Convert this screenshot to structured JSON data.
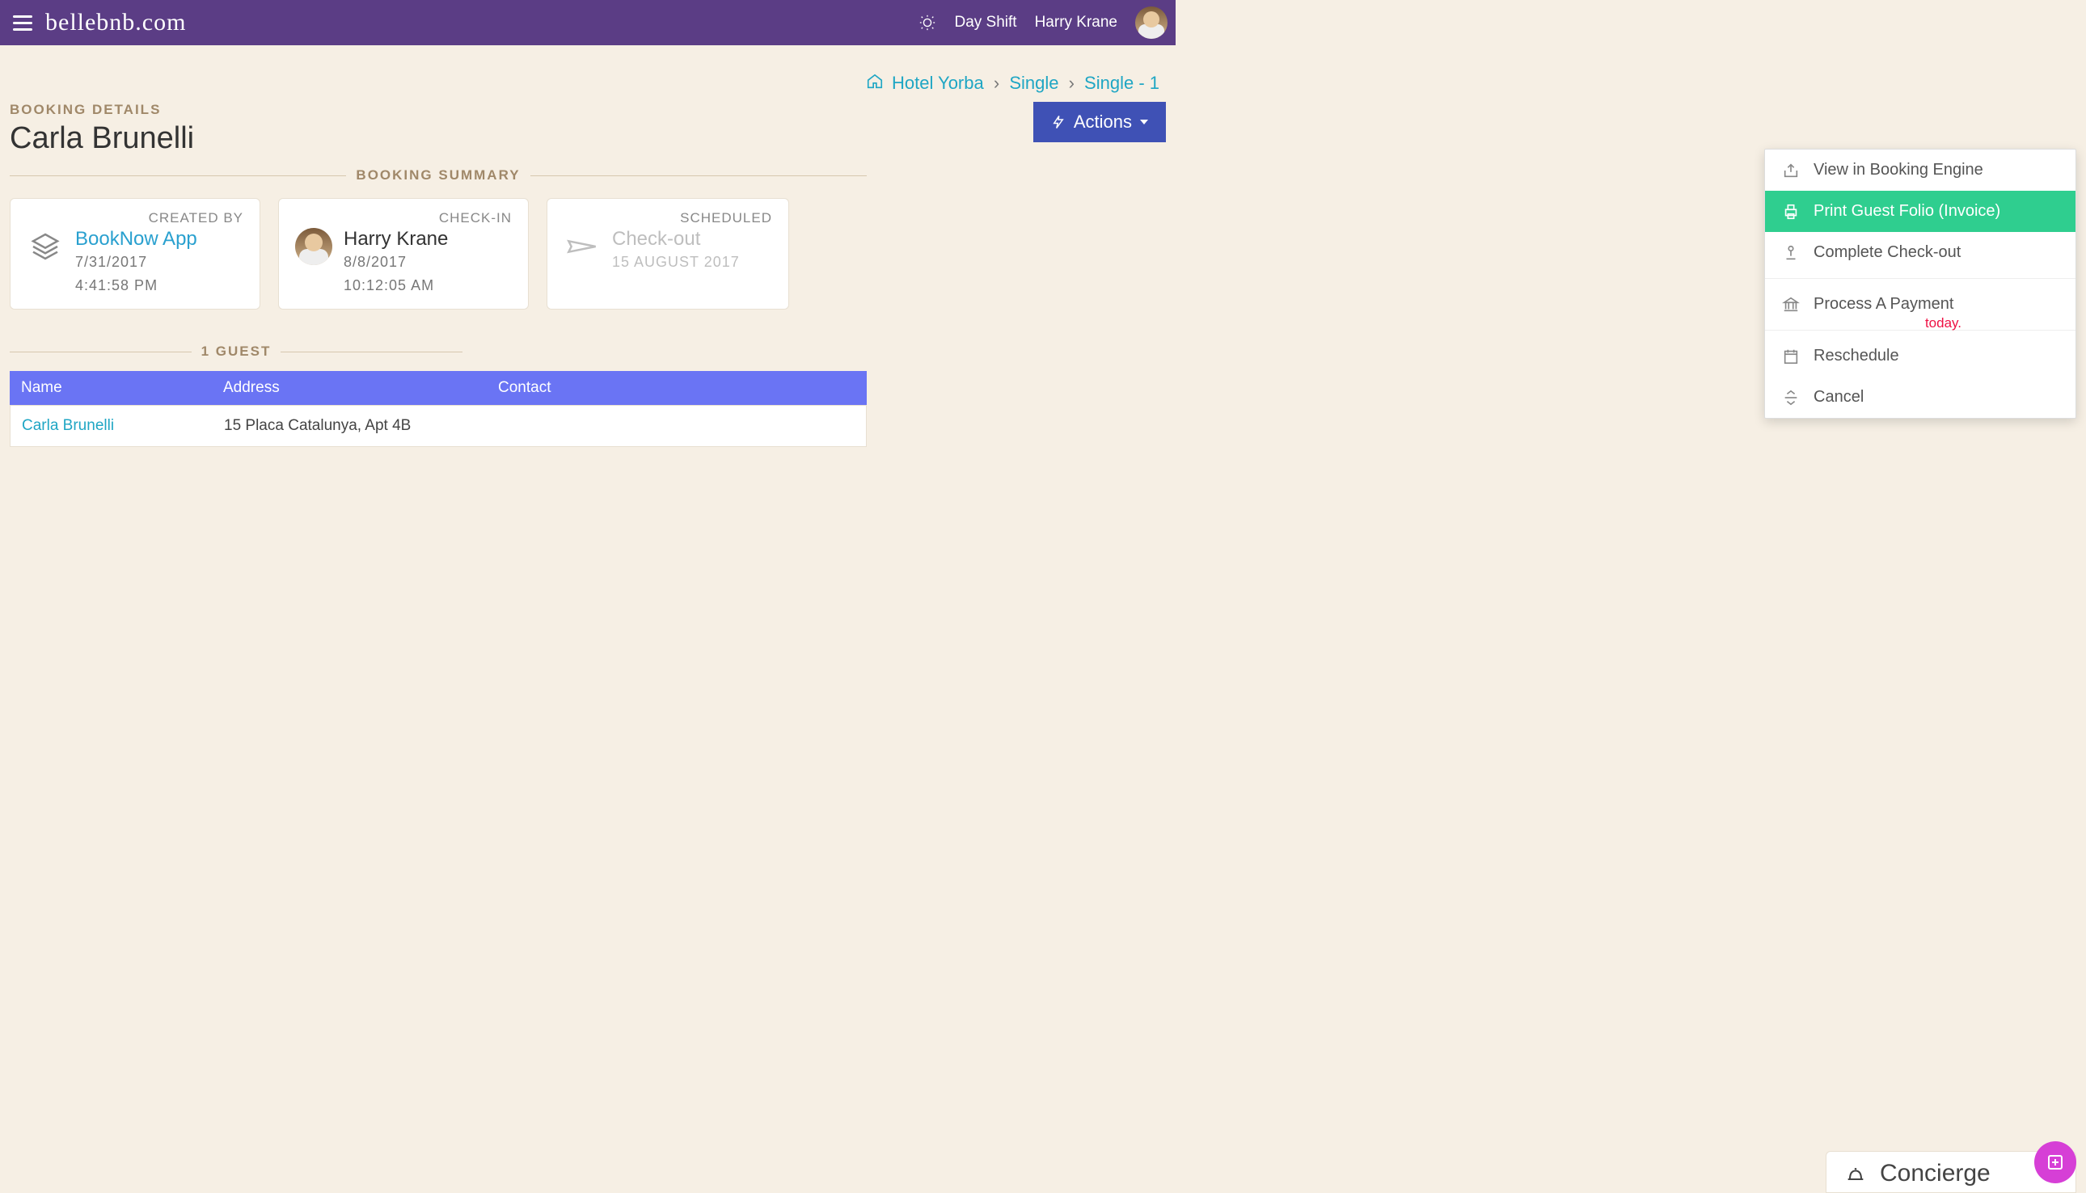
{
  "header": {
    "logo": "bellebnb.com",
    "shift_label": "Day Shift",
    "user_name": "Harry Krane"
  },
  "breadcrumbs": {
    "hotel": "Hotel Yorba",
    "room_type": "Single",
    "room": "Single - 1"
  },
  "booking": {
    "section_label": "BOOKING DETAILS",
    "guest_name": "Carla Brunelli",
    "summary_label": "BOOKING SUMMARY",
    "created_by": {
      "label": "CREATED BY",
      "source": "BookNow App",
      "date": "7/31/2017",
      "time": "4:41:58 PM"
    },
    "check_in": {
      "label": "CHECK-IN",
      "staff": "Harry Krane",
      "date": "8/8/2017",
      "time": "10:12:05 AM"
    },
    "scheduled": {
      "label": "SCHEDULED",
      "status": "Check-out",
      "date": "15 AUGUST 2017"
    }
  },
  "actions": {
    "button_label": "Actions",
    "items": [
      "View in Booking Engine",
      "Print Guest Folio (Invoice)",
      "Complete Check-out",
      "Process A Payment",
      "Reschedule",
      "Cancel"
    ]
  },
  "guests": {
    "section_label": "1 GUEST",
    "columns": {
      "name": "Name",
      "address": "Address",
      "contact": "Contact"
    },
    "rows": [
      {
        "name": "Carla Brunelli",
        "address": "15 Placa Catalunya, Apt 4B",
        "contact": ""
      }
    ]
  },
  "hints": {
    "today_tail": "today."
  },
  "concierge": {
    "label": "Concierge"
  }
}
